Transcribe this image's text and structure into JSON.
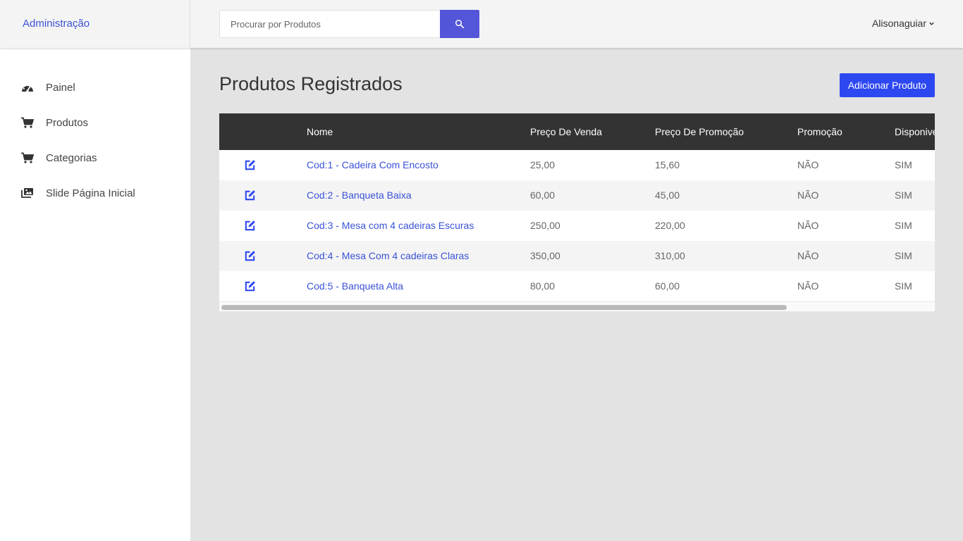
{
  "brand": "Administração",
  "search": {
    "placeholder": "Procurar por Produtos",
    "value": "",
    "button_icon": "search-icon"
  },
  "user": {
    "name": "Alisonaguiar",
    "icon": "chevron-down-icon"
  },
  "sidebar": {
    "items": [
      {
        "label": "Painel",
        "icon": "dashboard-icon"
      },
      {
        "label": "Produtos",
        "icon": "cart-icon"
      },
      {
        "label": "Categorias",
        "icon": "cart-icon"
      },
      {
        "label": "Slide Página Inicial",
        "icon": "images-icon"
      }
    ]
  },
  "page": {
    "title": "Produtos Registrados",
    "add_button": "Adicionar Produto"
  },
  "table": {
    "columns": [
      "",
      "Nome",
      "Preço De Venda",
      "Preço De Promoção",
      "Promoção",
      "Disponivel"
    ],
    "rows": [
      {
        "name": "Cod:1 - Cadeira Com Encosto",
        "price": "25,00",
        "promo_price": "15,60",
        "promo": "NÃO",
        "available": "SIM"
      },
      {
        "name": "Cod:2 - Banqueta Baixa",
        "price": "60,00",
        "promo_price": "45,00",
        "promo": "NÃO",
        "available": "SIM"
      },
      {
        "name": "Cod:3 - Mesa com 4 cadeiras Escuras",
        "price": "250,00",
        "promo_price": "220,00",
        "promo": "NÃO",
        "available": "SIM"
      },
      {
        "name": "Cod:4 - Mesa Com 4 cadeiras Claras",
        "price": "350,00",
        "promo_price": "310,00",
        "promo": "NÃO",
        "available": "SIM"
      },
      {
        "name": "Cod:5 - Banqueta Alta",
        "price": "80,00",
        "promo_price": "60,00",
        "promo": "NÃO",
        "available": "SIM"
      }
    ]
  },
  "colors": {
    "accent": "#3a52d6",
    "primary_button": "#2d48f0",
    "search_button": "#5356d8",
    "table_header": "#333333"
  }
}
